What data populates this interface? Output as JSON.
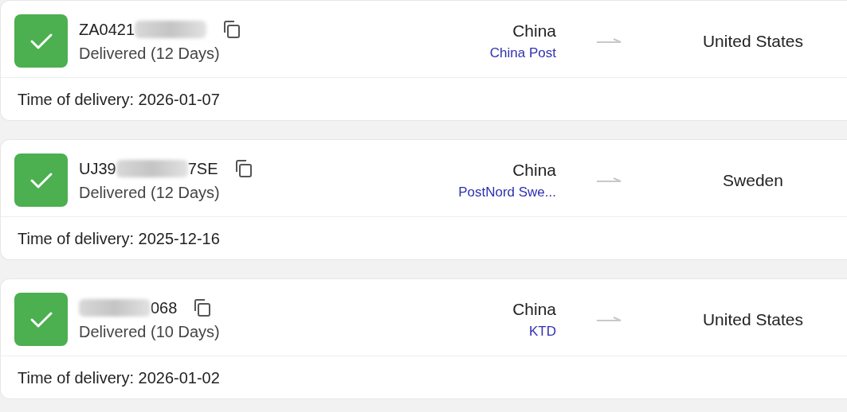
{
  "shipments": [
    {
      "delivered": true,
      "tracking_prefix": "ZA0421",
      "tracking_redacted": true,
      "status": "Delivered (12 Days)",
      "origin": "China",
      "carrier": "China Post",
      "destination": "United States",
      "delivery_label": "Time of delivery: 2026-01-07"
    },
    {
      "delivered": true,
      "tracking_prefix": "UJ39",
      "tracking_redacted": true,
      "tracking_suffix": "7SE",
      "status": "Delivered (12 Days)",
      "origin": "China",
      "carrier": "PostNord Swe...",
      "destination": "Sweden",
      "delivery_label": "Time of delivery: 2025-12-16"
    },
    {
      "delivered": true,
      "tracking_redacted": true,
      "tracking_suffix": "068",
      "status": "Delivered (10 Days)",
      "origin": "China",
      "carrier": "KTD",
      "destination": "United States",
      "delivery_label": "Time of delivery: 2026-01-02"
    }
  ]
}
